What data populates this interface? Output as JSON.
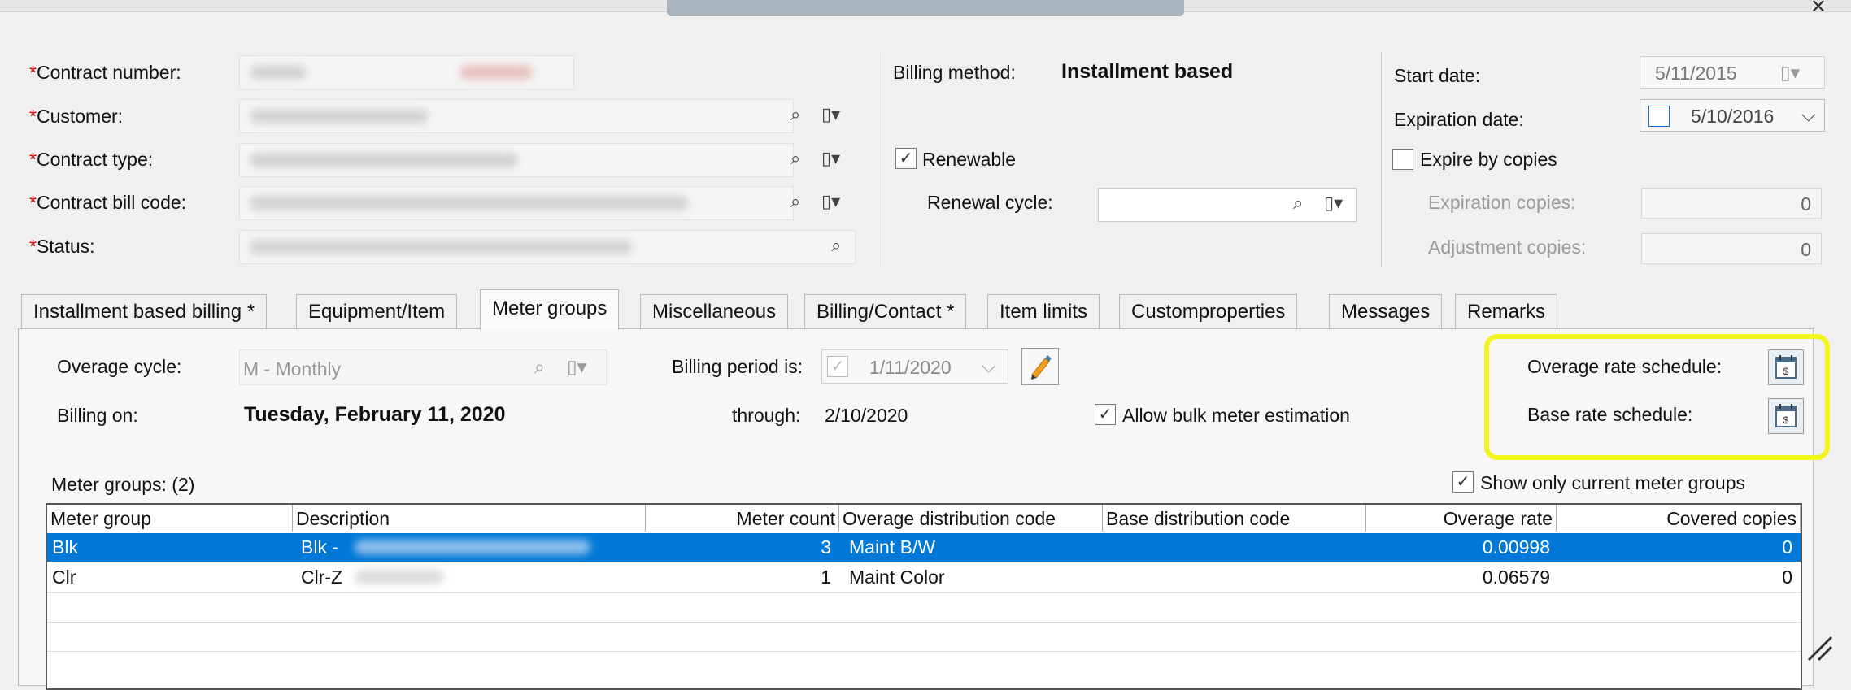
{
  "header": {
    "contract_number_label": "Contract number:",
    "customer_label": "Customer:",
    "contract_type_label": "Contract type:",
    "contract_bill_code_label": "Contract bill code:",
    "status_label": "Status:",
    "required_mark": "*",
    "billing_method_label": "Billing method:",
    "billing_method_value": "Installment based",
    "renewable_label": "Renewable",
    "renewal_cycle_label": "Renewal cycle:",
    "start_date_label": "Start date:",
    "start_date_value": "5/11/2015",
    "expiration_date_label": "Expiration date:",
    "expiration_date_value": "5/10/2016",
    "expire_by_copies_label": "Expire by copies",
    "expiration_copies_label": "Expiration copies:",
    "expiration_copies_value": "0",
    "adjustment_copies_label": "Adjustment copies:",
    "adjustment_copies_value": "0",
    "checkmark": "✓",
    "lookup_glyph": "⌕",
    "menu_glyph": "▯▾",
    "chevron_glyph": "⌵",
    "close_glyph": "✕"
  },
  "tabs": [
    {
      "label": "Installment based billing *"
    },
    {
      "label": "Equipment/Item"
    },
    {
      "label": "Meter groups"
    },
    {
      "label": "Miscellaneous"
    },
    {
      "label": "Billing/Contact *"
    },
    {
      "label": "Item limits"
    },
    {
      "label": "Customproperties"
    },
    {
      "label": "Messages"
    },
    {
      "label": "Remarks"
    }
  ],
  "meter_tab": {
    "overage_cycle_label": "Overage cycle:",
    "overage_cycle_value": "M - Monthly",
    "billing_period_label": "Billing period is:",
    "billing_period_value": "1/11/2020",
    "billing_on_label": "Billing on:",
    "billing_on_value": "Tuesday, February 11, 2020",
    "through_label": "through:",
    "through_value": "2/10/2020",
    "allow_bulk_label": "Allow bulk meter estimation",
    "overage_rate_schedule_label": "Overage rate schedule:",
    "base_rate_schedule_label": "Base rate schedule:",
    "meter_groups_count_label": "Meter groups: (2)",
    "show_only_current_label": "Show only current meter groups",
    "highlight_color": "#f3f31e",
    "selection_color": "#0078d7"
  },
  "grid": {
    "columns": [
      "Meter group",
      "Description",
      "Meter count",
      "Overage distribution code",
      "Base distribution code",
      "Overage rate",
      "Covered copies"
    ],
    "rows": [
      {
        "meter_group": "Blk",
        "description": "Blk -",
        "meter_count": "3",
        "overage_dist": "Maint B/W",
        "base_dist": "",
        "overage_rate": "0.00998",
        "covered": "0"
      },
      {
        "meter_group": "Clr",
        "description": "Clr-Z",
        "meter_count": "1",
        "overage_dist": "Maint Color",
        "base_dist": "",
        "overage_rate": "0.06579",
        "covered": "0"
      }
    ]
  }
}
